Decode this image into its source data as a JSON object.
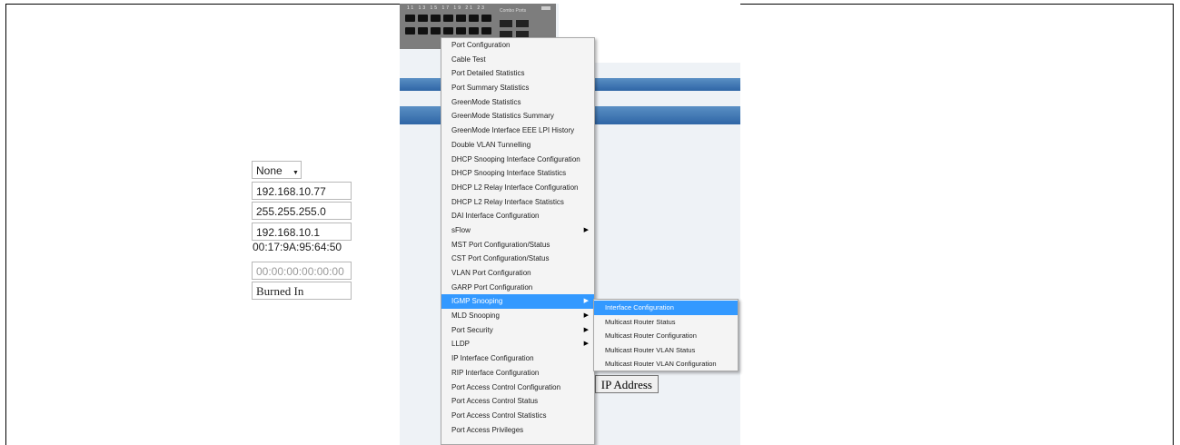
{
  "device": {
    "port_numbers": "11 13 15 17 19 21 23",
    "brand": "Combo Ports"
  },
  "form": {
    "select_value": "None",
    "ip_address": "192.168.10.77",
    "subnet_mask": "255.255.255.0",
    "gateway": "192.168.10.1",
    "mac_address": "00:17:9A:95:64:50",
    "local_mac": "00:00:00:00:00:00",
    "mac_type": "Burned In",
    "ip_button_label": "IP Address"
  },
  "menu": {
    "items": [
      {
        "label": "Port Configuration",
        "submenu": false
      },
      {
        "label": "Cable Test",
        "submenu": false
      },
      {
        "label": "Port Detailed Statistics",
        "submenu": false
      },
      {
        "label": "Port Summary Statistics",
        "submenu": false
      },
      {
        "label": "GreenMode Statistics",
        "submenu": false
      },
      {
        "label": "GreenMode Statistics Summary",
        "submenu": false
      },
      {
        "label": "GreenMode Interface EEE LPI History",
        "submenu": false
      },
      {
        "label": "Double VLAN Tunnelling",
        "submenu": false
      },
      {
        "label": "DHCP Snooping Interface Configuration",
        "submenu": false
      },
      {
        "label": "DHCP Snooping Interface Statistics",
        "submenu": false
      },
      {
        "label": "DHCP L2 Relay Interface Configuration",
        "submenu": false
      },
      {
        "label": "DHCP L2 Relay Interface Statistics",
        "submenu": false
      },
      {
        "label": "DAI Interface Configuration",
        "submenu": false
      },
      {
        "label": "sFlow",
        "submenu": true
      },
      {
        "label": "MST Port Configuration/Status",
        "submenu": false
      },
      {
        "label": "CST Port Configuration/Status",
        "submenu": false
      },
      {
        "label": "VLAN Port Configuration",
        "submenu": false
      },
      {
        "label": "GARP Port Configuration",
        "submenu": false
      },
      {
        "label": "IGMP Snooping",
        "submenu": true,
        "highlighted": true
      },
      {
        "label": "MLD Snooping",
        "submenu": true
      },
      {
        "label": "Port Security",
        "submenu": true
      },
      {
        "label": "LLDP",
        "submenu": true
      },
      {
        "label": "IP Interface Configuration",
        "submenu": false
      },
      {
        "label": "RIP Interface Configuration",
        "submenu": false
      },
      {
        "label": "Port Access Control Configuration",
        "submenu": false
      },
      {
        "label": "Port Access Control Status",
        "submenu": false
      },
      {
        "label": "Port Access Control Statistics",
        "submenu": false
      },
      {
        "label": "Port Access Privileges",
        "submenu": false
      }
    ],
    "arrow_glyph": "▶"
  },
  "submenu": {
    "items": [
      {
        "label": "Interface Configuration",
        "highlighted": true
      },
      {
        "label": "Multicast Router Status"
      },
      {
        "label": "Multicast Router Configuration"
      },
      {
        "label": "Multicast Router VLAN Status"
      },
      {
        "label": "Multicast Router VLAN Configuration"
      }
    ]
  },
  "colors": {
    "highlight": "#3399ff",
    "band": "#2f66a6"
  }
}
